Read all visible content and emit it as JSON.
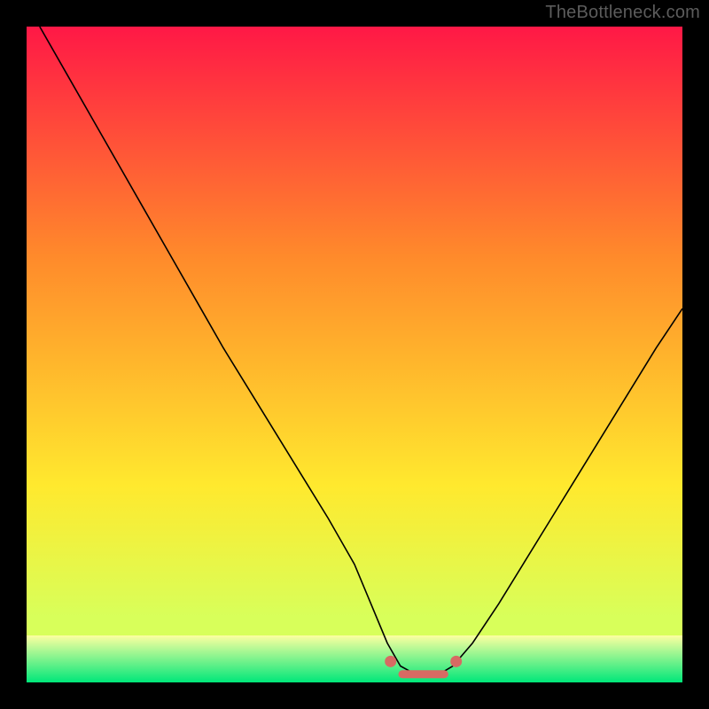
{
  "attribution": "TheBottleneck.com",
  "chart_data": {
    "type": "line",
    "title": "",
    "xlabel": "",
    "ylabel": "",
    "xlim": [
      0,
      100
    ],
    "ylim": [
      0,
      100
    ],
    "grid": false,
    "legend": false,
    "background_gradient": {
      "top": "#ff1846",
      "mid_upper": "#ff8a2b",
      "mid_lower": "#ffe92e",
      "near_bottom": "#d8ff5a",
      "bottom_band_top": "#fdffa0",
      "bottom_band_bottom": "#00e77a"
    },
    "series": [
      {
        "name": "curve",
        "color": "#000000",
        "x": [
          2,
          6,
          10,
          14,
          18,
          22,
          26,
          30,
          34,
          38,
          42,
          46,
          50,
          52.5,
          55,
          57,
          59,
          61,
          63,
          65,
          68,
          72,
          76,
          80,
          84,
          88,
          92,
          96,
          100
        ],
        "y": [
          100,
          93,
          86,
          79,
          72,
          65,
          58,
          51,
          44.5,
          38,
          31.5,
          25,
          18,
          12,
          6,
          2.5,
          1.4,
          1.2,
          1.3,
          2.5,
          6,
          12,
          18.5,
          25,
          31.5,
          38,
          44.5,
          51,
          57
        ]
      },
      {
        "name": "flat-bottom-marker",
        "color": "#d76a63",
        "marker_x": [
          55.5,
          65.5
        ],
        "marker_y": [
          3.2,
          3.2
        ],
        "flat_x": [
          57.3,
          63.7
        ],
        "flat_y": [
          1.25,
          1.25
        ]
      }
    ]
  }
}
